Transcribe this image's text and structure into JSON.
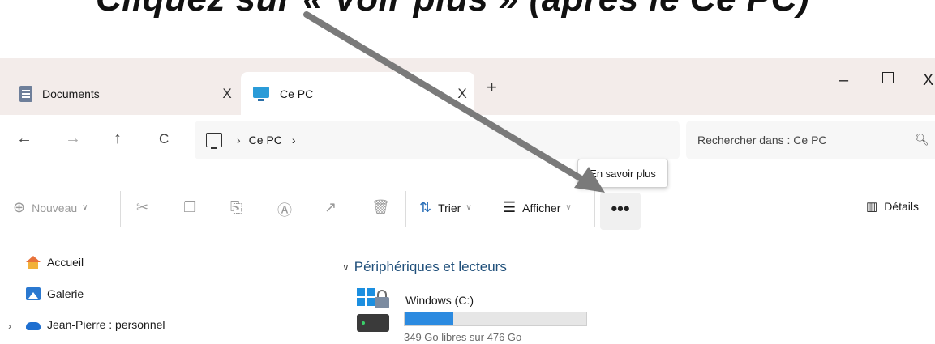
{
  "caption": {
    "text": "Cliquez sur « Voir plus » (après le Ce PC)"
  },
  "tabs": [
    {
      "label": "Documents",
      "close": "X",
      "active": false
    },
    {
      "label": "Ce PC",
      "close": "X",
      "active": true
    }
  ],
  "new_tab": "+",
  "window": {
    "minimize": "–",
    "close": "X"
  },
  "nav": {
    "back": "←",
    "forward": "→",
    "up": "↑",
    "refresh": "C",
    "breadcrumb": [
      "Ce PC"
    ],
    "sep": "›",
    "trail_sep": "›"
  },
  "search": {
    "placeholder": "Rechercher dans : Ce PC",
    "icon": "search-icon"
  },
  "toolbar": {
    "new": "Nouveau",
    "sort": "Trier",
    "view": "Afficher",
    "more": "•••",
    "details": "Détails",
    "tooltip": "En savoir plus"
  },
  "sidebar": {
    "items": [
      {
        "label": "Accueil",
        "icon": "home-icon"
      },
      {
        "label": "Galerie",
        "icon": "gallery-icon"
      },
      {
        "label": "Jean-Pierre : personnel",
        "icon": "onedrive-cloud-icon"
      }
    ]
  },
  "main": {
    "section_title": "Périphériques et lecteurs",
    "drive": {
      "name": "Windows (C:)",
      "free_text": "349 Go libres sur 476 Go",
      "used_fraction": 0.267
    }
  },
  "colors": {
    "titlebar_bg": "#f3ecea",
    "accent": "#2b8ae0",
    "annotation_arrow": "#7a7a7a"
  }
}
